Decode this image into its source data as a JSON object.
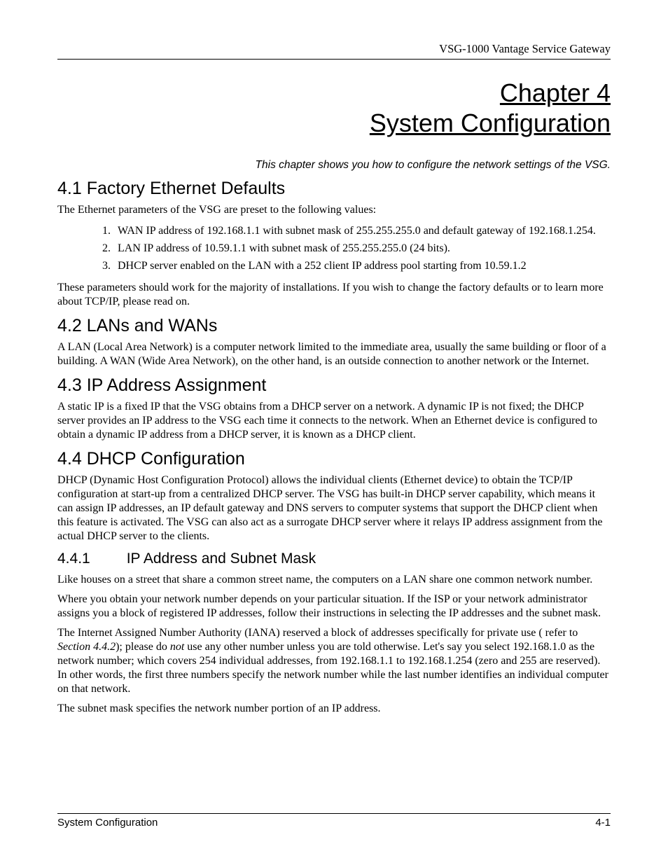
{
  "header": {
    "product": "VSG-1000 Vantage Service Gateway"
  },
  "chapter": {
    "line1": "Chapter 4",
    "line2": "System Configuration",
    "subtitle": "This chapter shows you how to configure the network settings of the VSG."
  },
  "s41": {
    "heading": "4.1  Factory Ethernet Defaults",
    "intro": "The Ethernet parameters of the VSG are preset to the following values:",
    "items": {
      "0": "WAN IP address of 192.168.1.1 with subnet mask of 255.255.255.0 and default gateway of 192.168.1.254.",
      "1": "LAN IP address of 10.59.1.1 with subnet mask of 255.255.255.0 (24 bits).",
      "2": "DHCP server enabled on the LAN with a 252 client IP address pool starting from 10.59.1.2"
    },
    "outro": "These parameters should work for the majority of installations. If you wish to change the factory defaults or to learn more about TCP/IP, please read on."
  },
  "s42": {
    "heading": "4.2  LANs and WANs",
    "body": "A LAN (Local Area Network) is a computer network limited to the immediate area, usually the same building or floor of a building.  A WAN (Wide Area Network), on the other hand, is an outside connection to another network or the Internet."
  },
  "s43": {
    "heading": "4.3  IP Address Assignment",
    "body": "A static IP is a fixed IP that the VSG obtains from a DHCP server on a network. A dynamic IP is not fixed; the DHCP server provides an IP address to the VSG each time it connects to the network. When an Ethernet device is configured to obtain a dynamic IP address from a DHCP server, it is known as a DHCP client."
  },
  "s44": {
    "heading": "4.4  DHCP Configuration",
    "body": "DHCP (Dynamic Host Configuration Protocol) allows the individual clients (Ethernet device) to obtain the TCP/IP configuration at start-up from a centralized DHCP server. The VSG has built-in DHCP server capability, which means it can assign IP addresses, an IP default gateway and DNS servers to computer systems that support the DHCP client when this feature is activated. The VSG can also act as a surrogate DHCP server where it relays IP address assignment from the actual DHCP server to the clients."
  },
  "s441": {
    "num": "4.4.1",
    "title": "IP Address and Subnet Mask",
    "p1": "Like houses on a street that share a common street name, the computers on a LAN share one common network number.",
    "p2": "Where you obtain your network number depends on your particular situation.  If the ISP or your network administrator assigns you a block of registered IP addresses, follow their instructions in selecting the IP addresses and the subnet mask.",
    "p3a": "The Internet Assigned Number Authority (IANA) reserved a block of addresses specifically for private use ( refer to ",
    "p3ref": "Section  4.4.2",
    "p3b": "); please do ",
    "p3not": "not",
    "p3c": " use any other number unless you are told otherwise.  Let's say you select 192.168.1.0 as the network number; which covers 254 individual addresses, from 192.168.1.1 to 192.168.1.254 (zero and 255 are reserved).  In other words, the first three numbers specify the network number while the last number identifies an individual computer on that network.",
    "p4": "The subnet mask specifies the network number portion of an IP address."
  },
  "footer": {
    "left": "System Configuration",
    "right": "4-1"
  }
}
